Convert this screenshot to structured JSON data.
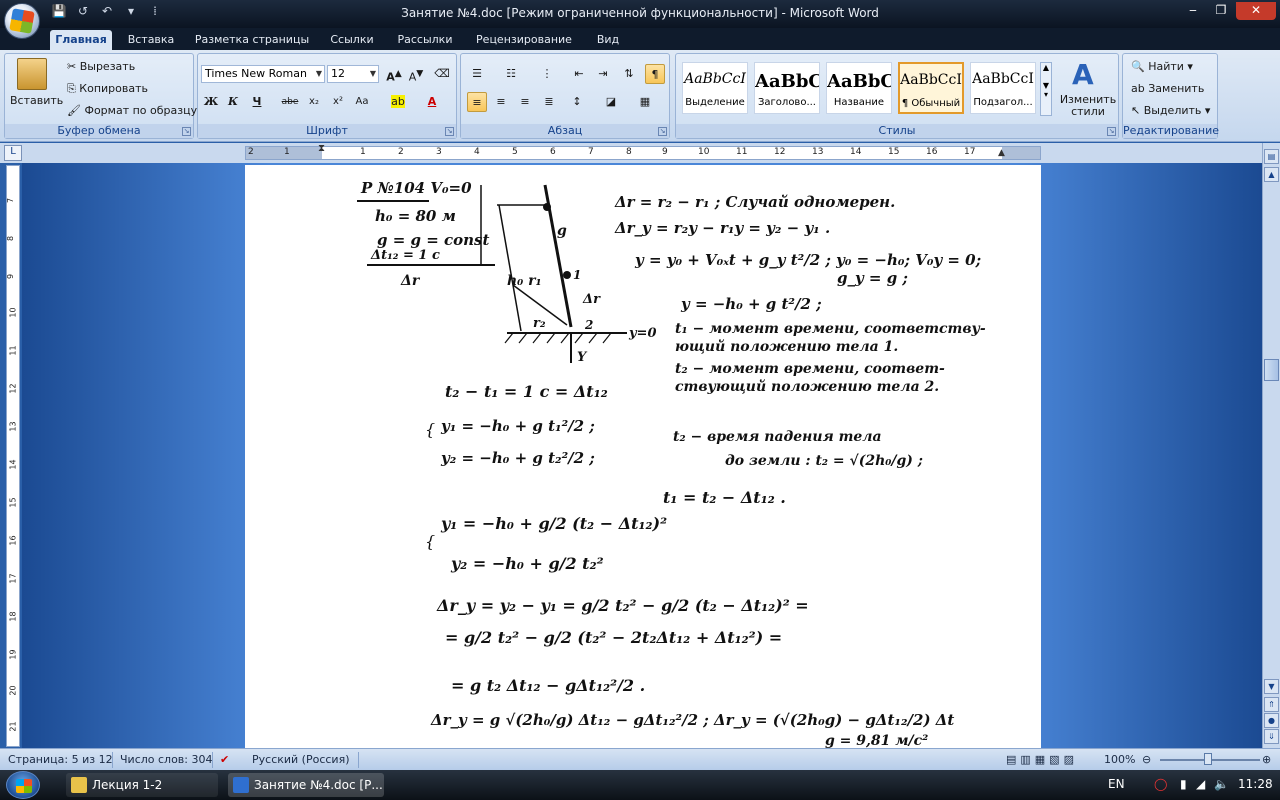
{
  "window": {
    "title": "Занятие №4.doc [Режим ограниченной функциональности] - Microsoft Word",
    "controls": [
      "‒",
      "❐",
      "✕"
    ]
  },
  "quick_access": [
    "💾",
    "↺",
    "↶",
    "▾",
    "⁞"
  ],
  "tabs": [
    "Главная",
    "Вставка",
    "Разметка страницы",
    "Ссылки",
    "Рассылки",
    "Рецензирование",
    "Вид"
  ],
  "ribbon": {
    "clipboard": {
      "label": "Буфер обмена",
      "paste": "Вставить",
      "cut": "Вырезать",
      "copy": "Копировать",
      "format_painter": "Формат по образцу"
    },
    "font": {
      "label": "Шрифт",
      "family": "Times New Roman",
      "size": "12",
      "buttons": [
        "Ж",
        "К",
        "Ч",
        "abe",
        "x₂",
        "x²",
        "Aa"
      ]
    },
    "paragraph": {
      "label": "Абзац"
    },
    "styles": {
      "label": "Стилы",
      "items": [
        {
          "preview": "AaBbCcI",
          "name": "Выделение"
        },
        {
          "preview": "AaBbC",
          "name": "Заголово..."
        },
        {
          "preview": "AaBbC",
          "name": "Название"
        },
        {
          "preview": "AaBbCcI",
          "name": "¶ Обычный"
        },
        {
          "preview": "AaBbCcI",
          "name": "Подзагол..."
        }
      ],
      "change_styles": "Изменить стили"
    },
    "editing": {
      "label": "Редактирование",
      "find": "Найти",
      "replace": "Заменить",
      "select": "Выделить"
    }
  },
  "ruler": {
    "ticks": [
      "2",
      "1",
      "1",
      "2",
      "3",
      "4",
      "5",
      "6",
      "7",
      "8",
      "9",
      "10",
      "11",
      "12",
      "13",
      "14",
      "15",
      "16",
      "17"
    ],
    "vticks": [
      "7",
      "8",
      "9",
      "10",
      "11",
      "12",
      "13",
      "14",
      "15",
      "16",
      "17",
      "18",
      "19",
      "20",
      "21"
    ]
  },
  "document": {
    "heading": "Р №104  V₀=0",
    "given": [
      "h₀ = 80 м",
      "g = g = const",
      "Δt₁₂ = 1 с",
      "Δr"
    ],
    "lines": [
      "Δr = r₂ − r₁ ;  Случай одномерен.",
      "Δr_y = r₂y − r₁y = y₂ − y₁ .",
      "y = y₀ + V₀ₓt + g_y t²/2 ;  y₀ = −h₀; V₀y = 0;",
      "g_y = g ;",
      "y = −h₀ + g t²/2 ;",
      "t₁ − момент времени, соответству-",
      "ющий положению тела 1.",
      "t₂ − момент времени, соответ-",
      "ствующий положению тела 2.",
      "t₂ − t₁ = 1 с = Δt₁₂",
      "y₁ = −h₀ + g t₁²/2 ;",
      "y₂ = −h₀ + g t₂²/2 ;",
      "t₂ − время падения тела",
      "до земли :  t₂ = √(2h₀/g) ;",
      "t₁ = t₂ − Δt₁₂ .",
      "y₁ = −h₀ + g/2 (t₂ − Δt₁₂)²",
      "y₂ = −h₀ + g/2 t₂²",
      "Δr_y = y₂ − y₁ = g/2 t₂² − g/2 (t₂ − Δt₁₂)² =",
      "= g/2 t₂² − g/2 (t₂² − 2t₂Δt₁₂ + Δt₁₂²) =",
      "= g t₂ Δt₁₂ − gΔt₁₂²/2 .",
      "Δr_y = g √(2h₀/g) Δt₁₂ − gΔt₁₂²/2 ;  Δr_y = (√(2h₀g) − gΔt₁₂/2) Δt",
      "g = 9,81 м/с²"
    ],
    "diagram_labels": {
      "g": "g",
      "h0r": "h₀ r₁",
      "r2": "r₂",
      "dr": "Δr",
      "p1": "1",
      "p2": "2",
      "y0": "y=0",
      "Y": "Y"
    }
  },
  "status": {
    "page": "Страница: 5 из 12",
    "words": "Число слов: 304",
    "language": "Русский (Россия)",
    "zoom": "100%"
  },
  "taskbar": {
    "tasks": [
      "Лекция 1-2",
      "Занятие №4.doc [Р..."
    ],
    "lang": "EN",
    "time": "11:28"
  }
}
